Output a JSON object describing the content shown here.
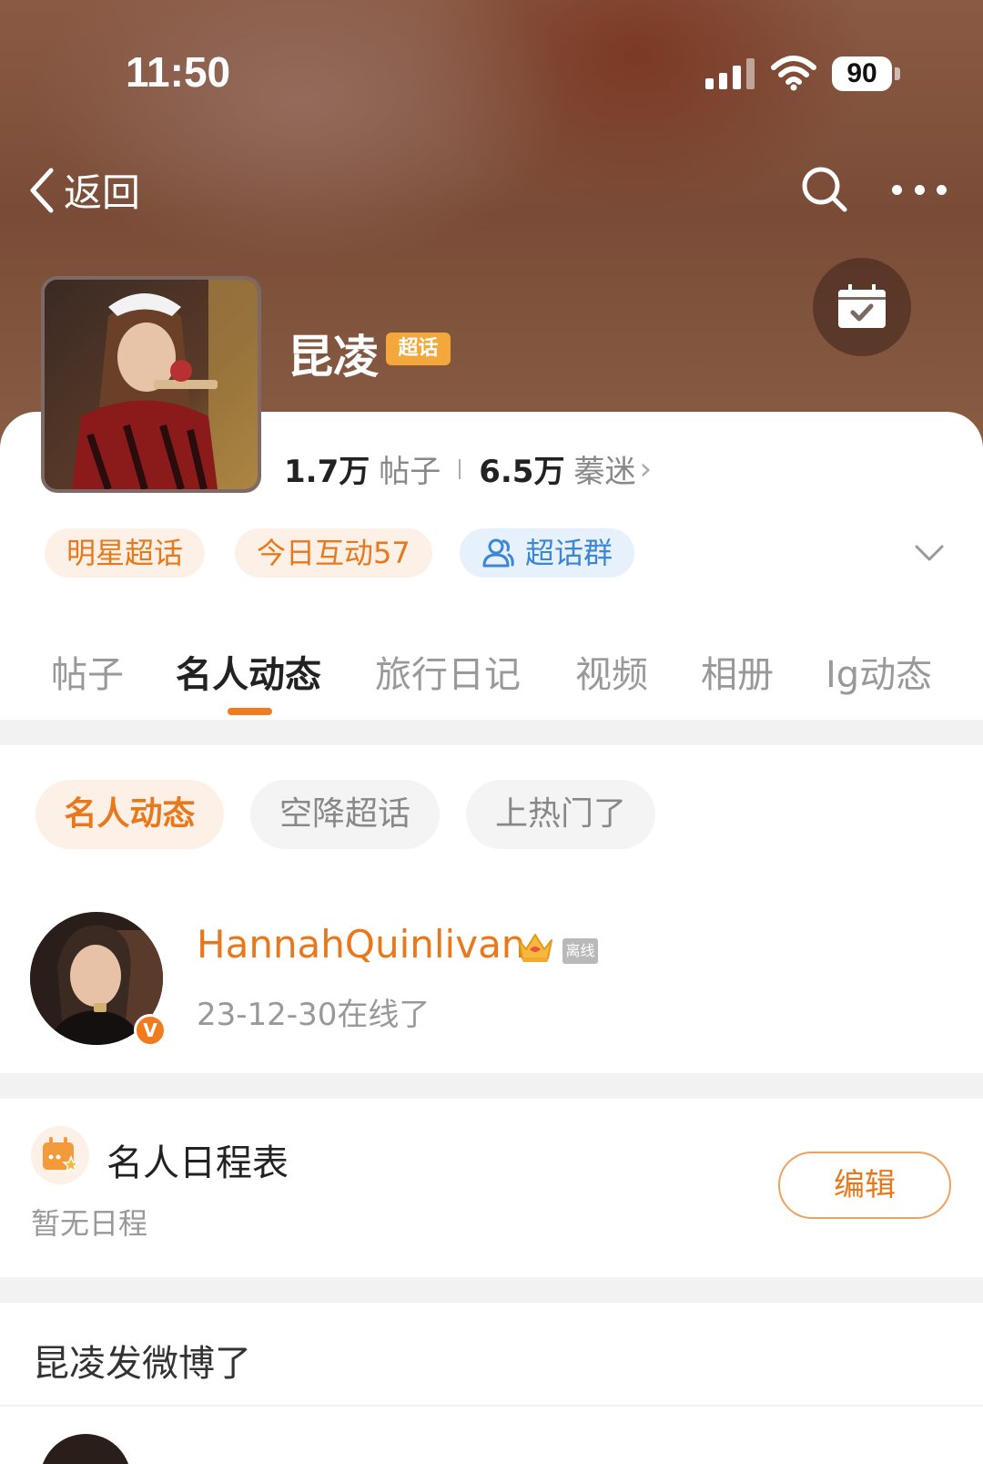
{
  "status_bar": {
    "time": "11:50",
    "battery": "90"
  },
  "nav": {
    "back_label": "返回"
  },
  "topic": {
    "name": "昆凌",
    "badge": "超话",
    "posts_count": "1.7万",
    "posts_label": "帖子",
    "fans_count": "6.5万",
    "fans_label": "蓁迷",
    "fans_arrow": "›"
  },
  "chips": [
    {
      "label": "明星超话"
    },
    {
      "label": "今日互动57"
    },
    {
      "label": "超话群"
    }
  ],
  "tabs": [
    {
      "label": "帖子"
    },
    {
      "label": "名人动态",
      "active": true
    },
    {
      "label": "旅行日记"
    },
    {
      "label": "视频"
    },
    {
      "label": "相册"
    },
    {
      "label": "Ig动态"
    }
  ],
  "subtabs": [
    {
      "label": "名人动态",
      "active": true
    },
    {
      "label": "空降超话"
    },
    {
      "label": "上热门了"
    }
  ],
  "celebrity": {
    "name": "HannahQuinlivan",
    "status_badge": "离线",
    "verified_mark": "V",
    "online_text": "23-12-30在线了"
  },
  "schedule": {
    "title": "名人日程表",
    "empty_text": "暂无日程",
    "edit_label": "编辑"
  },
  "posted": {
    "title": "昆凌发微博了"
  },
  "colors": {
    "accent": "#e9781c",
    "blue_chip": "#3b86d6",
    "header_bg": "#7a4c37"
  }
}
